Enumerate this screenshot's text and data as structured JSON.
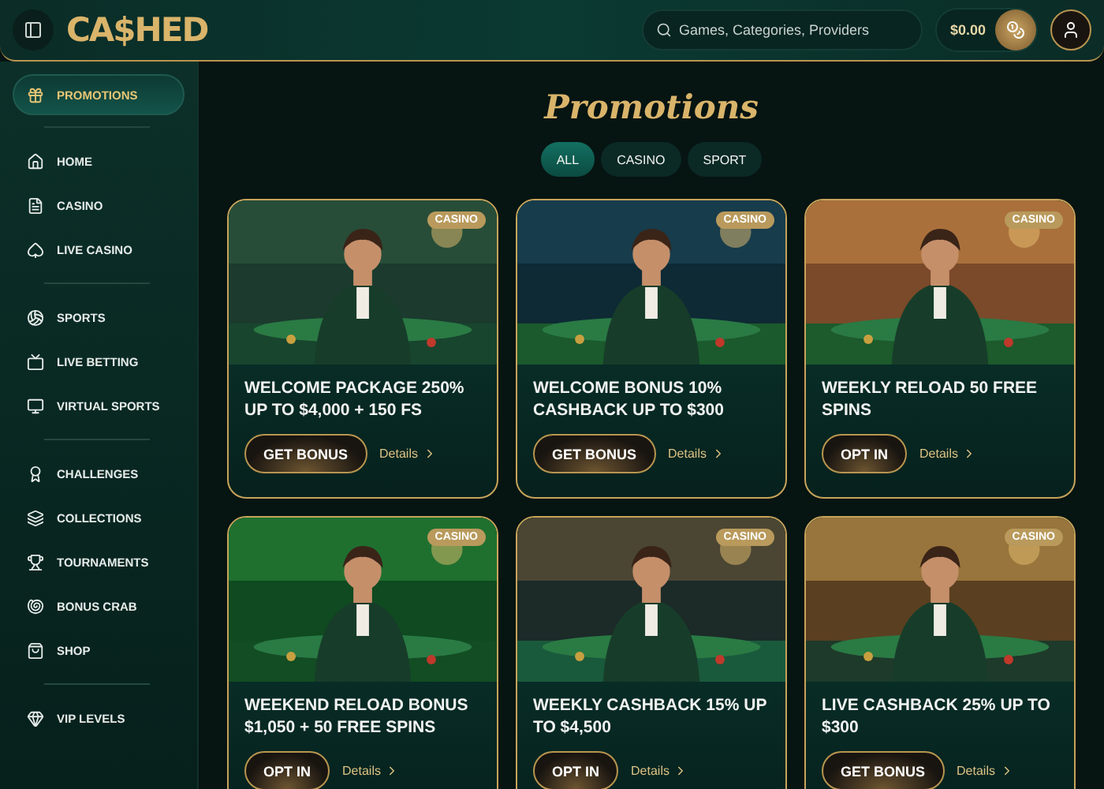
{
  "header": {
    "search": {
      "placeholder": "Games, Categories, Providers"
    },
    "balance": "$0.00"
  },
  "logo": "CA$HED",
  "sidebar": {
    "groups": [
      [
        {
          "label": "PROMOTIONS",
          "selected": true
        }
      ],
      [
        {
          "label": "HOME",
          "selected": false
        },
        {
          "label": "CASINO",
          "selected": false
        },
        {
          "label": "LIVE CASINO",
          "selected": false
        }
      ],
      [
        {
          "label": "SPORTS",
          "selected": false
        },
        {
          "label": "LIVE BETTING",
          "selected": false
        },
        {
          "label": "VIRTUAL SPORTS",
          "selected": false
        }
      ],
      [
        {
          "label": "CHALLENGES",
          "selected": false
        },
        {
          "label": "COLLECTIONS",
          "selected": false
        },
        {
          "label": "TOURNAMENTS",
          "selected": false
        },
        {
          "label": "BONUS CRAB",
          "selected": false
        },
        {
          "label": "SHOP",
          "selected": false
        }
      ],
      [
        {
          "label": "VIP LEVELS",
          "selected": false
        }
      ]
    ]
  },
  "title": "Promotions",
  "tabs": [
    {
      "label": "ALL",
      "selected": true
    },
    {
      "label": "CASINO",
      "selected": false
    },
    {
      "label": "SPORT",
      "selected": false
    }
  ],
  "promotions": [
    {
      "badge": "CASINO",
      "title": "WELCOME PACKAGE 250% UP TO $4,000 + 150 FS",
      "button": "GET BONUS",
      "link": "Details"
    },
    {
      "badge": "CASINO",
      "title": "WELCOME BONUS 10% CASHBACK UP TO $300",
      "button": "GET BONUS",
      "link": "Details"
    },
    {
      "badge": "CASINO",
      "title": "WEEKLY RELOAD 50 FREE SPINS",
      "button": "OPT IN",
      "link": "Details"
    },
    {
      "badge": "CASINO",
      "title": "WEEKEND RELOAD BONUS $1,050 + 50 FREE SPINS",
      "button": "OPT IN",
      "link": "Details"
    },
    {
      "badge": "CASINO",
      "title": "WEEKLY CASHBACK 15% UP TO $4,500",
      "button": "OPT IN",
      "link": "Details"
    },
    {
      "badge": "CASINO",
      "title": "LIVE CASHBACK 25% UP TO $300",
      "button": "GET BONUS",
      "link": "Details"
    }
  ]
}
